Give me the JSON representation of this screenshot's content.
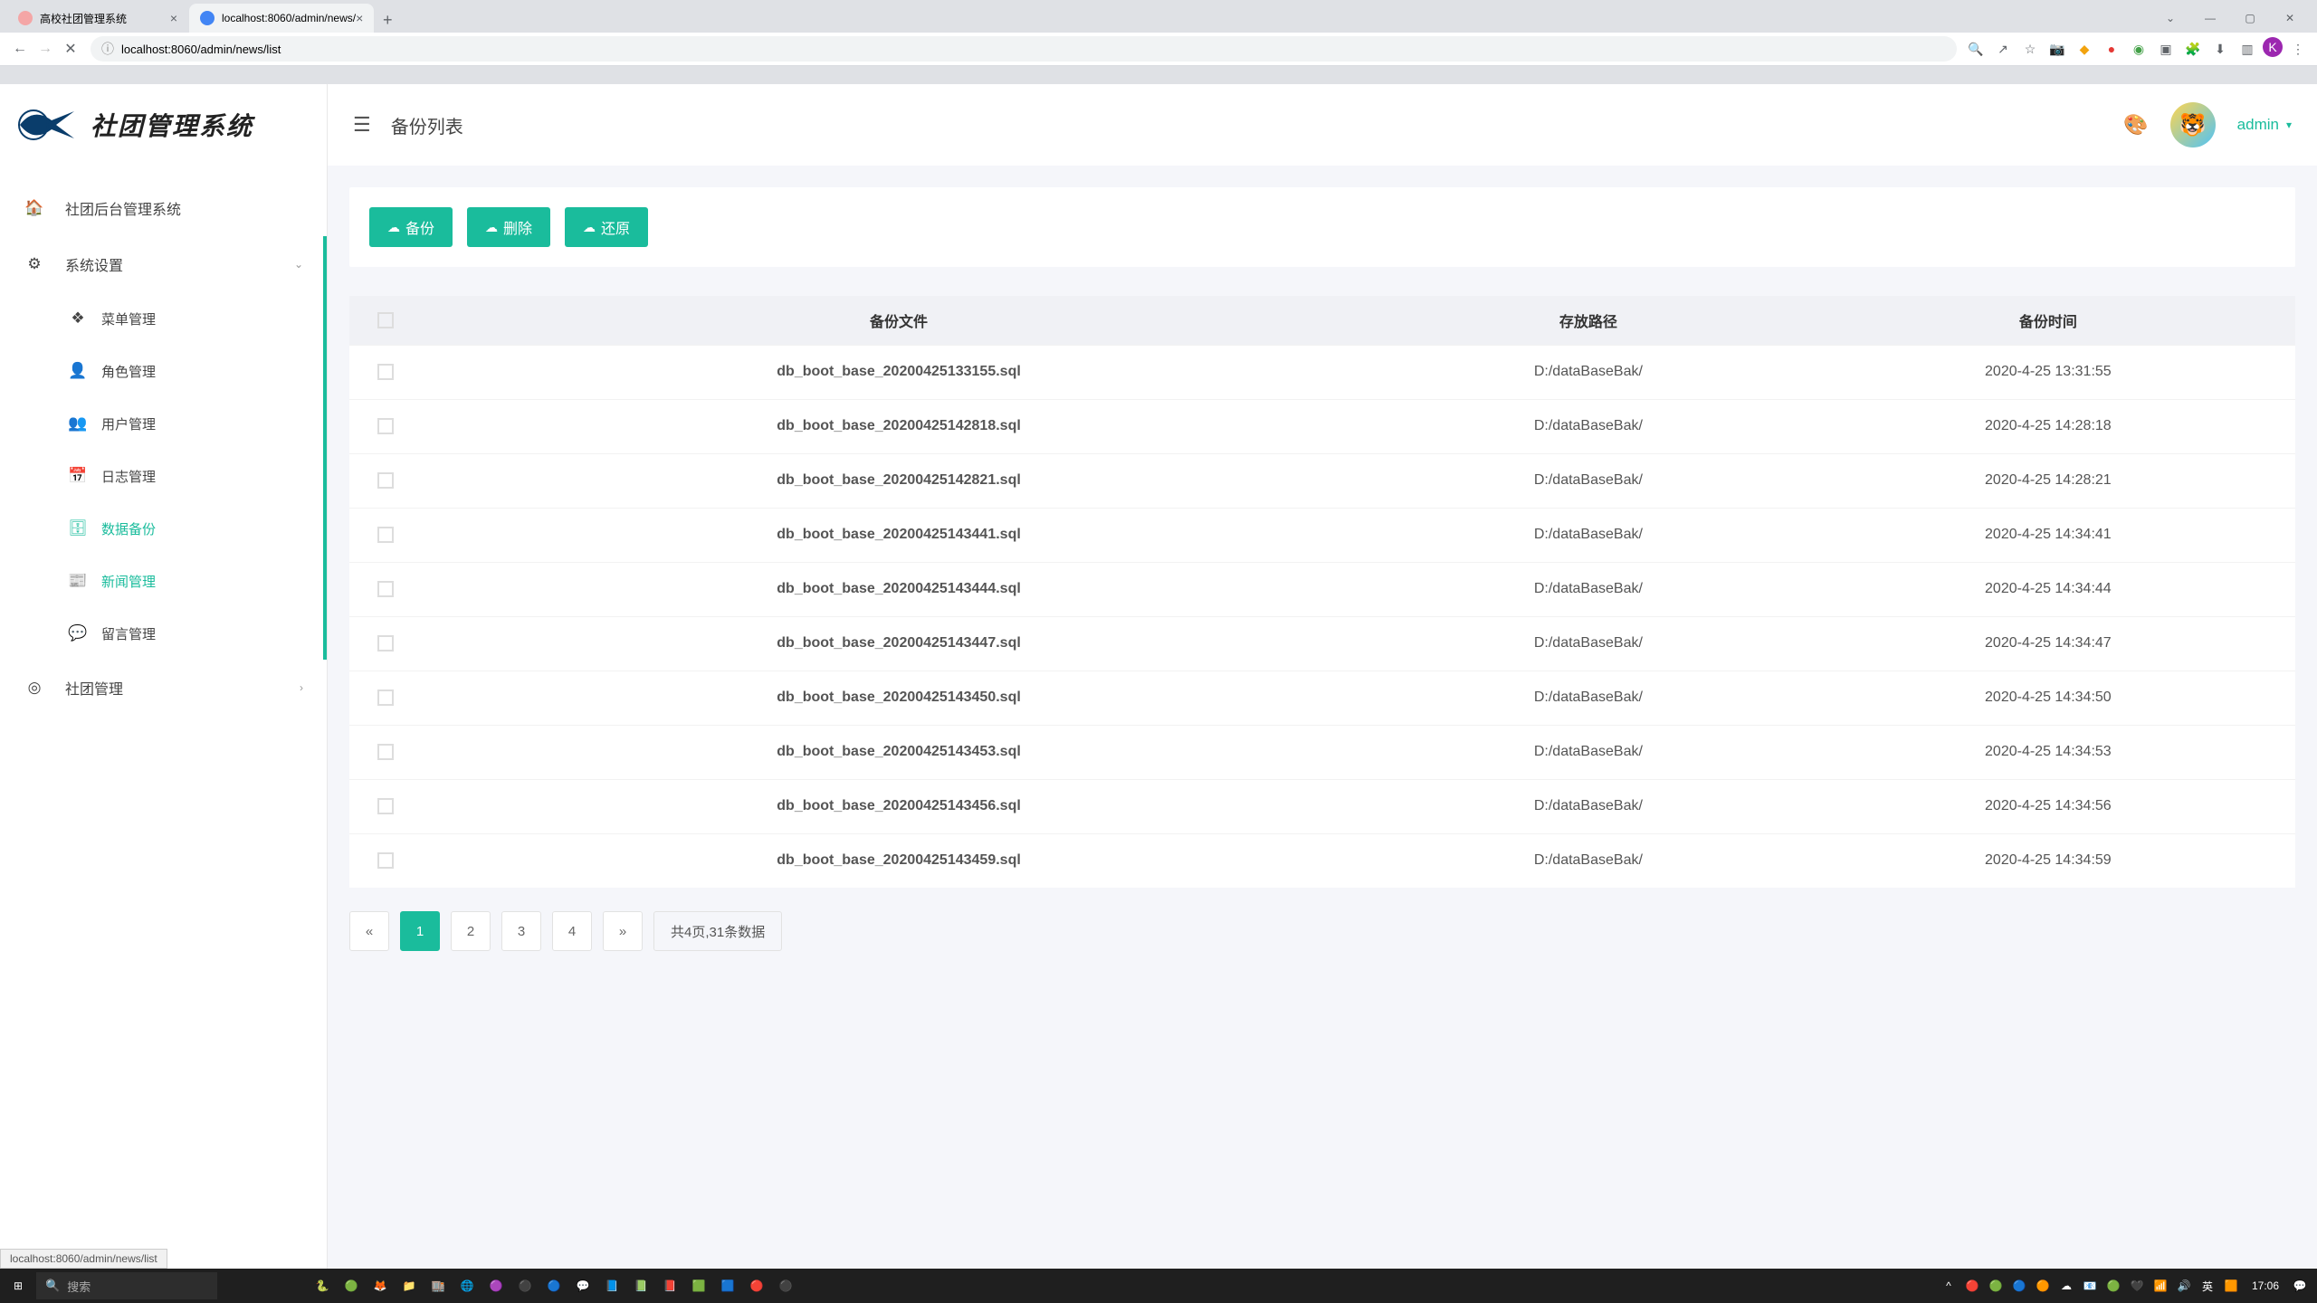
{
  "browser": {
    "tabs": [
      {
        "title": "高校社团管理系统",
        "favicon": "pink",
        "active": false
      },
      {
        "title": "localhost:8060/admin/news/",
        "favicon": "blue",
        "active": true
      }
    ],
    "url": "localhost:8060/admin/news/list",
    "statusUrl": "localhost:8060/admin/news/list"
  },
  "logo": {
    "text": "社团管理系统"
  },
  "header": {
    "title": "备份列表",
    "user": "admin"
  },
  "sidebar": {
    "home": "社团后台管理系统",
    "settings": "系统设置",
    "menus": [
      {
        "label": "菜单管理",
        "icon": "❖",
        "active": false
      },
      {
        "label": "角色管理",
        "icon": "👤",
        "active": false
      },
      {
        "label": "用户管理",
        "icon": "👥",
        "active": false
      },
      {
        "label": "日志管理",
        "icon": "📅",
        "active": false
      },
      {
        "label": "数据备份",
        "icon": "🗄",
        "active": true
      },
      {
        "label": "新闻管理",
        "icon": "📰",
        "active": true
      },
      {
        "label": "留言管理",
        "icon": "💬",
        "active": false
      }
    ],
    "clubMgmt": "社团管理"
  },
  "actions": {
    "backup": "备份",
    "delete": "删除",
    "restore": "还原"
  },
  "table": {
    "headers": {
      "file": "备份文件",
      "path": "存放路径",
      "time": "备份时间"
    },
    "rows": [
      {
        "file": "db_boot_base_20200425133155.sql",
        "path": "D:/dataBaseBak/",
        "time": "2020-4-25 13:31:55"
      },
      {
        "file": "db_boot_base_20200425142818.sql",
        "path": "D:/dataBaseBak/",
        "time": "2020-4-25 14:28:18"
      },
      {
        "file": "db_boot_base_20200425142821.sql",
        "path": "D:/dataBaseBak/",
        "time": "2020-4-25 14:28:21"
      },
      {
        "file": "db_boot_base_20200425143441.sql",
        "path": "D:/dataBaseBak/",
        "time": "2020-4-25 14:34:41"
      },
      {
        "file": "db_boot_base_20200425143444.sql",
        "path": "D:/dataBaseBak/",
        "time": "2020-4-25 14:34:44"
      },
      {
        "file": "db_boot_base_20200425143447.sql",
        "path": "D:/dataBaseBak/",
        "time": "2020-4-25 14:34:47"
      },
      {
        "file": "db_boot_base_20200425143450.sql",
        "path": "D:/dataBaseBak/",
        "time": "2020-4-25 14:34:50"
      },
      {
        "file": "db_boot_base_20200425143453.sql",
        "path": "D:/dataBaseBak/",
        "time": "2020-4-25 14:34:53"
      },
      {
        "file": "db_boot_base_20200425143456.sql",
        "path": "D:/dataBaseBak/",
        "time": "2020-4-25 14:34:56"
      },
      {
        "file": "db_boot_base_20200425143459.sql",
        "path": "D:/dataBaseBak/",
        "time": "2020-4-25 14:34:59"
      }
    ]
  },
  "pagination": {
    "pages": [
      "1",
      "2",
      "3",
      "4"
    ],
    "current": "1",
    "prev": "«",
    "next": "»",
    "info": "共4页,31条数据"
  },
  "taskbar": {
    "search": "搜索",
    "time": "17:06"
  }
}
